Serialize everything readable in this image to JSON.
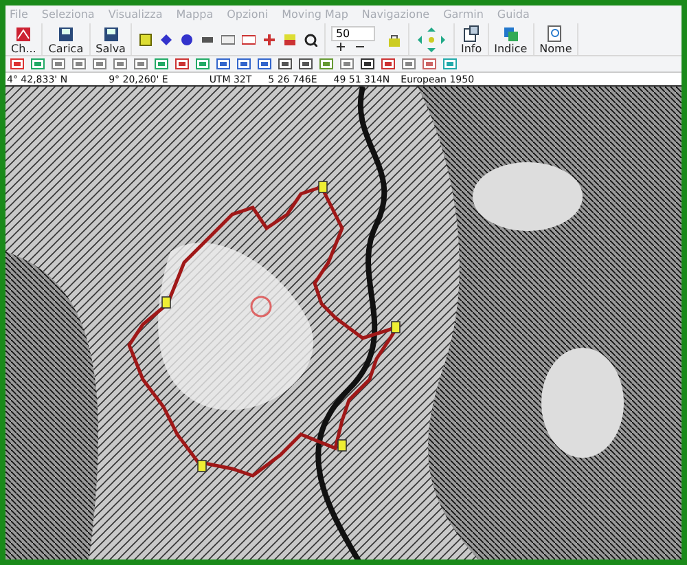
{
  "menu": [
    {
      "label": "File"
    },
    {
      "label": "Seleziona"
    },
    {
      "label": "Visualizza"
    },
    {
      "label": "Mappa"
    },
    {
      "label": "Opzioni"
    },
    {
      "label": "Moving Map"
    },
    {
      "label": "Navigazione"
    },
    {
      "label": "Garmin"
    },
    {
      "label": "Guida"
    }
  ],
  "toolbar": [
    {
      "kind": "button",
      "label": "Ch..."
    },
    {
      "kind": "button",
      "label": "Carica"
    },
    {
      "kind": "button",
      "label": "Salva"
    },
    {
      "kind": "icons"
    },
    {
      "kind": "zoom",
      "value": "50"
    },
    {
      "kind": "button",
      "label": "Info"
    },
    {
      "kind": "button",
      "label": "Indice"
    },
    {
      "kind": "button",
      "label": "Nome"
    }
  ],
  "coords": [
    "4° 42,833' N",
    "9° 20,260' E",
    "UTM 32T",
    "5 26 746E",
    "49 51 314N",
    "European 1950"
  ]
}
